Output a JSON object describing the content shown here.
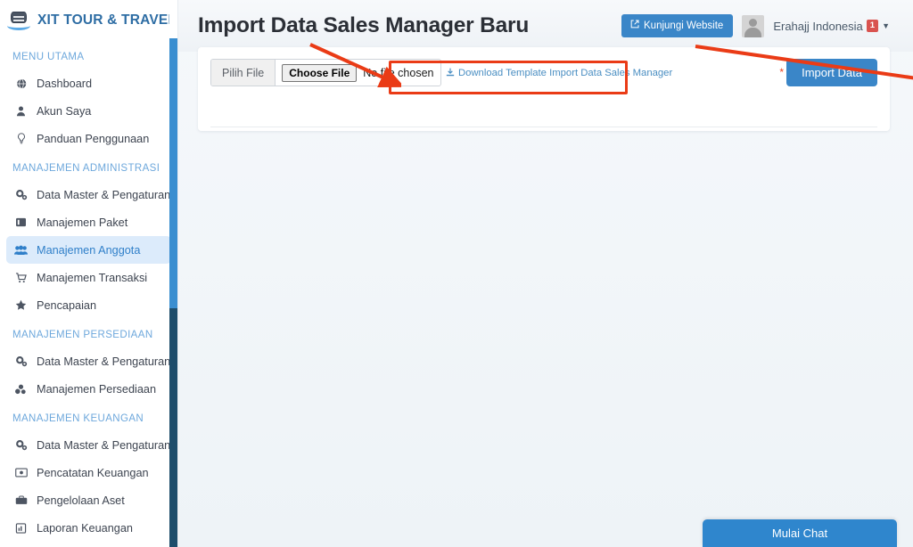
{
  "brand": {
    "name": "XIT TOUR & TRAVEL",
    "logo_icon": "database-logo-icon"
  },
  "sidebar": {
    "sections": [
      {
        "heading": "MENU UTAMA",
        "items": [
          {
            "label": "Dashboard",
            "icon": "globe-icon",
            "active": false
          },
          {
            "label": "Akun Saya",
            "icon": "user-icon",
            "active": false
          },
          {
            "label": "Panduan Penggunaan",
            "icon": "lightbulb-icon",
            "active": false
          }
        ]
      },
      {
        "heading": "MANAJEMEN ADMINISTRASI",
        "items": [
          {
            "label": "Data Master & Pengaturan",
            "icon": "gears-icon",
            "active": false
          },
          {
            "label": "Manajemen Paket",
            "icon": "book-icon",
            "active": false
          },
          {
            "label": "Manajemen Anggota",
            "icon": "users-icon",
            "active": true
          },
          {
            "label": "Manajemen Transaksi",
            "icon": "cart-icon",
            "active": false
          },
          {
            "label": "Pencapaian",
            "icon": "star-half-icon",
            "active": false
          }
        ]
      },
      {
        "heading": "MANAJEMEN PERSEDIAAN",
        "items": [
          {
            "label": "Data Master & Pengaturan",
            "icon": "gears-icon",
            "active": false
          },
          {
            "label": "Manajemen Persediaan",
            "icon": "boxes-icon",
            "active": false
          }
        ]
      },
      {
        "heading": "MANAJEMEN KEUANGAN",
        "items": [
          {
            "label": "Data Master & Pengaturan",
            "icon": "gears-icon",
            "active": false
          },
          {
            "label": "Pencatatan Keuangan",
            "icon": "money-bill-icon",
            "active": false
          },
          {
            "label": "Pengelolaan Aset",
            "icon": "briefcase-icon",
            "active": false
          },
          {
            "label": "Laporan Keuangan",
            "icon": "file-report-icon",
            "active": false
          }
        ]
      }
    ]
  },
  "header": {
    "title": "Import Data Sales Manager Baru",
    "visit_website_label": "Kunjungi Website",
    "visit_website_icon": "external-link-icon",
    "user_name": "Erahajj Indonesia",
    "user_badge": "1",
    "caret_icon": "chevron-down-icon",
    "avatar_icon": "avatar-placeholder-icon"
  },
  "import_card": {
    "file_prefix_label": "Pilih File",
    "choose_file_label": "Choose File",
    "no_file_text": "No file chosen",
    "download_template_label": "Download Template Import Data Sales Manager",
    "download_icon": "download-icon",
    "required_marker": "*",
    "import_button_label": "Import Data"
  },
  "chat": {
    "label": "Mulai Chat"
  },
  "colors": {
    "brand_blue": "#2e6da4",
    "primary_button": "#3a86c8",
    "active_nav_bg": "#dcebfb",
    "active_nav_text": "#2f7fc9",
    "section_heading": "#6ea8dc",
    "annotation_red": "#ea3b16",
    "badge_red": "#d9534f",
    "scrollbar_thumb": "#3a8ed0",
    "scrollbar_track": "#1e4d6b",
    "page_bg": "#eef2f6"
  }
}
